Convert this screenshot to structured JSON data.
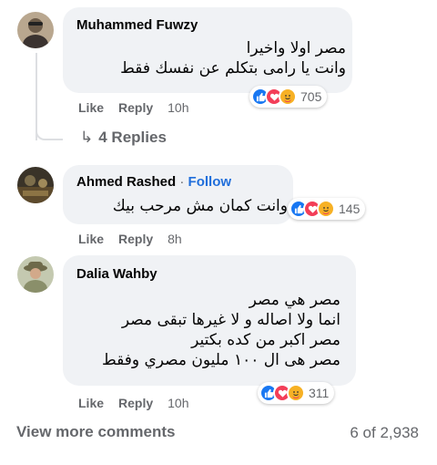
{
  "comments": [
    {
      "author": "Muhammed Fuwzy",
      "lines": [
        "مصر اولا واخيرا",
        "وانت يا رامى بتكلم عن نفسك فقط"
      ],
      "reaction_count": "705",
      "like": "Like",
      "reply": "Reply",
      "time": "10h"
    },
    {
      "author": "Ahmed Rashed",
      "separator": "·",
      "follow": "Follow",
      "lines": [
        "وانت كمان مش مرحب بيك"
      ],
      "reaction_count": "145",
      "like": "Like",
      "reply": "Reply",
      "time": "8h"
    },
    {
      "author": "Dalia Wahby",
      "lines": [
        "مصر هي مصر",
        "انما ولا اصاله و لا غيرها تبقى مصر",
        "مصر اكبر من كده بكتير",
        "مصر هى ال ١٠٠ مليون مصري وفقط"
      ],
      "reaction_count": "311",
      "like": "Like",
      "reply": "Reply",
      "time": "10h"
    }
  ],
  "replies_link": {
    "arrow": "↳",
    "label": "4 Replies"
  },
  "footer": {
    "view_more": "View more comments",
    "count": "6 of 2,938"
  },
  "colors": {
    "like": "#1877f2",
    "love": "#f33e58",
    "care": "#f7b125",
    "link": "#216fdb"
  },
  "icons": [
    "like-icon",
    "love-icon",
    "care-icon",
    "reply-arrow-icon"
  ]
}
